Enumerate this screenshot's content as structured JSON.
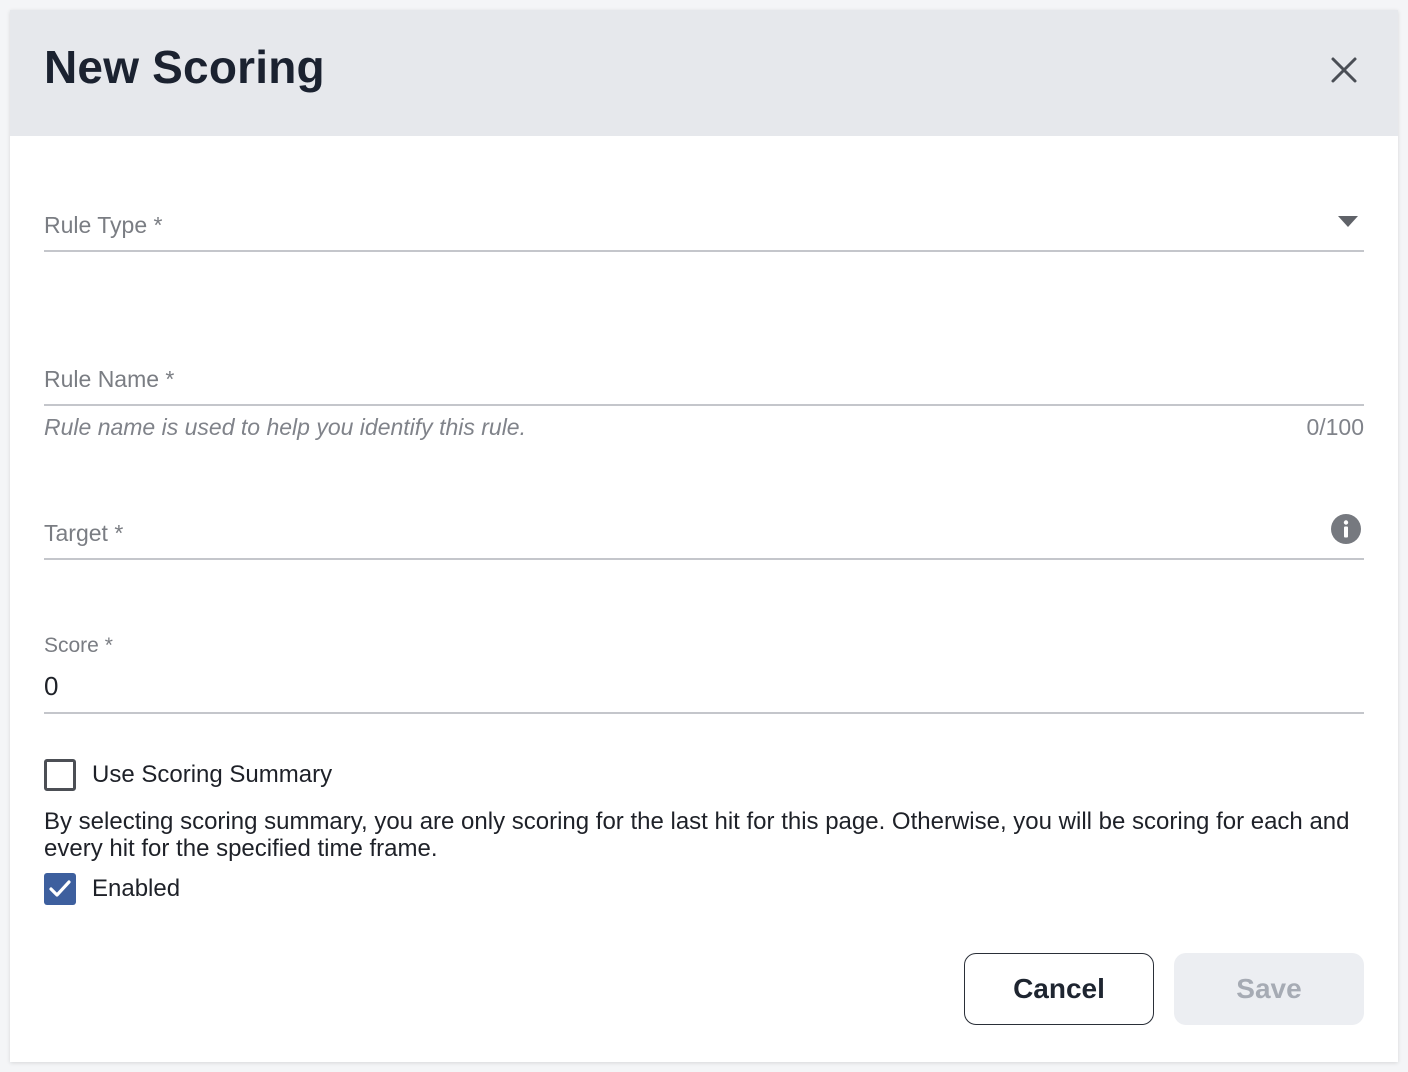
{
  "dialog": {
    "title": "New Scoring"
  },
  "fields": {
    "rule_type": {
      "label": "Rule Type *"
    },
    "rule_name": {
      "label": "Rule Name *",
      "hint": "Rule name is used to help you identify this rule.",
      "counter": "0/100"
    },
    "target": {
      "label": "Target *"
    },
    "score": {
      "label": "Score *",
      "value": "0"
    }
  },
  "options": {
    "use_scoring_summary": {
      "label": "Use Scoring Summary",
      "checked": false
    },
    "description": "By selecting scoring summary, you are only scoring for the last hit for this page. Otherwise, you will be scoring for each and every hit for the specified time frame.",
    "enabled": {
      "label": "Enabled",
      "checked": true
    }
  },
  "actions": {
    "cancel_label": "Cancel",
    "save_label": "Save"
  },
  "icons": {
    "close": "close-icon",
    "dropdown": "caret-down-icon",
    "info": "info-icon",
    "check": "checkmark-icon"
  },
  "colors": {
    "header_bg": "#e6e8ec",
    "checkbox_checked": "#3d5f9e",
    "save_disabled_bg": "#eceef2"
  }
}
